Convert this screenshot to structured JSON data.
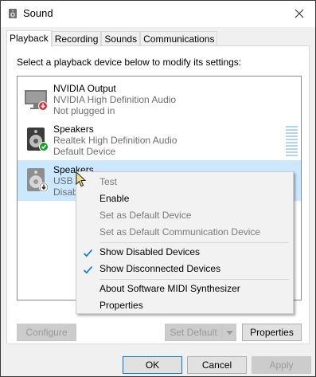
{
  "window": {
    "title": "Sound"
  },
  "tabs": [
    {
      "label": "Playback",
      "active": true
    },
    {
      "label": "Recording",
      "active": false
    },
    {
      "label": "Sounds",
      "active": false
    },
    {
      "label": "Communications",
      "active": false
    }
  ],
  "playback": {
    "instruction": "Select a playback device below to modify its settings:",
    "devices": [
      {
        "name": "NVIDIA Output",
        "driver": "NVIDIA High Definition Audio",
        "status": "Not plugged in",
        "icon": "monitor-speaker-icon",
        "badge": "unplugged-badge"
      },
      {
        "name": "Speakers",
        "driver": "Realtek High Definition Audio",
        "status": "Default Device",
        "icon": "speaker-icon",
        "badge": "default-check-badge"
      },
      {
        "name": "Speakers",
        "driver": "USB Au",
        "status": "Disable",
        "icon": "speaker-icon",
        "badge": "disabled-badge",
        "selected": true
      }
    ]
  },
  "context_menu": {
    "items": [
      {
        "label": "Test",
        "enabled": false
      },
      {
        "label": "Enable",
        "enabled": true
      },
      {
        "label": "Set as Default Device",
        "enabled": false
      },
      {
        "label": "Set as Default Communication Device",
        "enabled": false
      },
      {
        "label": "Show Disabled Devices",
        "enabled": true,
        "checked": true
      },
      {
        "label": "Show Disconnected Devices",
        "enabled": true,
        "checked": true
      },
      {
        "label": "About Software MIDI Synthesizer",
        "enabled": true
      },
      {
        "label": "Properties",
        "enabled": true
      }
    ]
  },
  "panel_buttons": {
    "configure": "Configure",
    "set_default": "Set Default",
    "properties": "Properties"
  },
  "dialog_buttons": {
    "ok": "OK",
    "cancel": "Cancel",
    "apply": "Apply"
  },
  "colors": {
    "selection": "#cce8ff",
    "accent": "#0078d7",
    "check_blue": "#0078d7",
    "default_green": "#1a9e2a",
    "unplugged_red": "#d13438"
  }
}
